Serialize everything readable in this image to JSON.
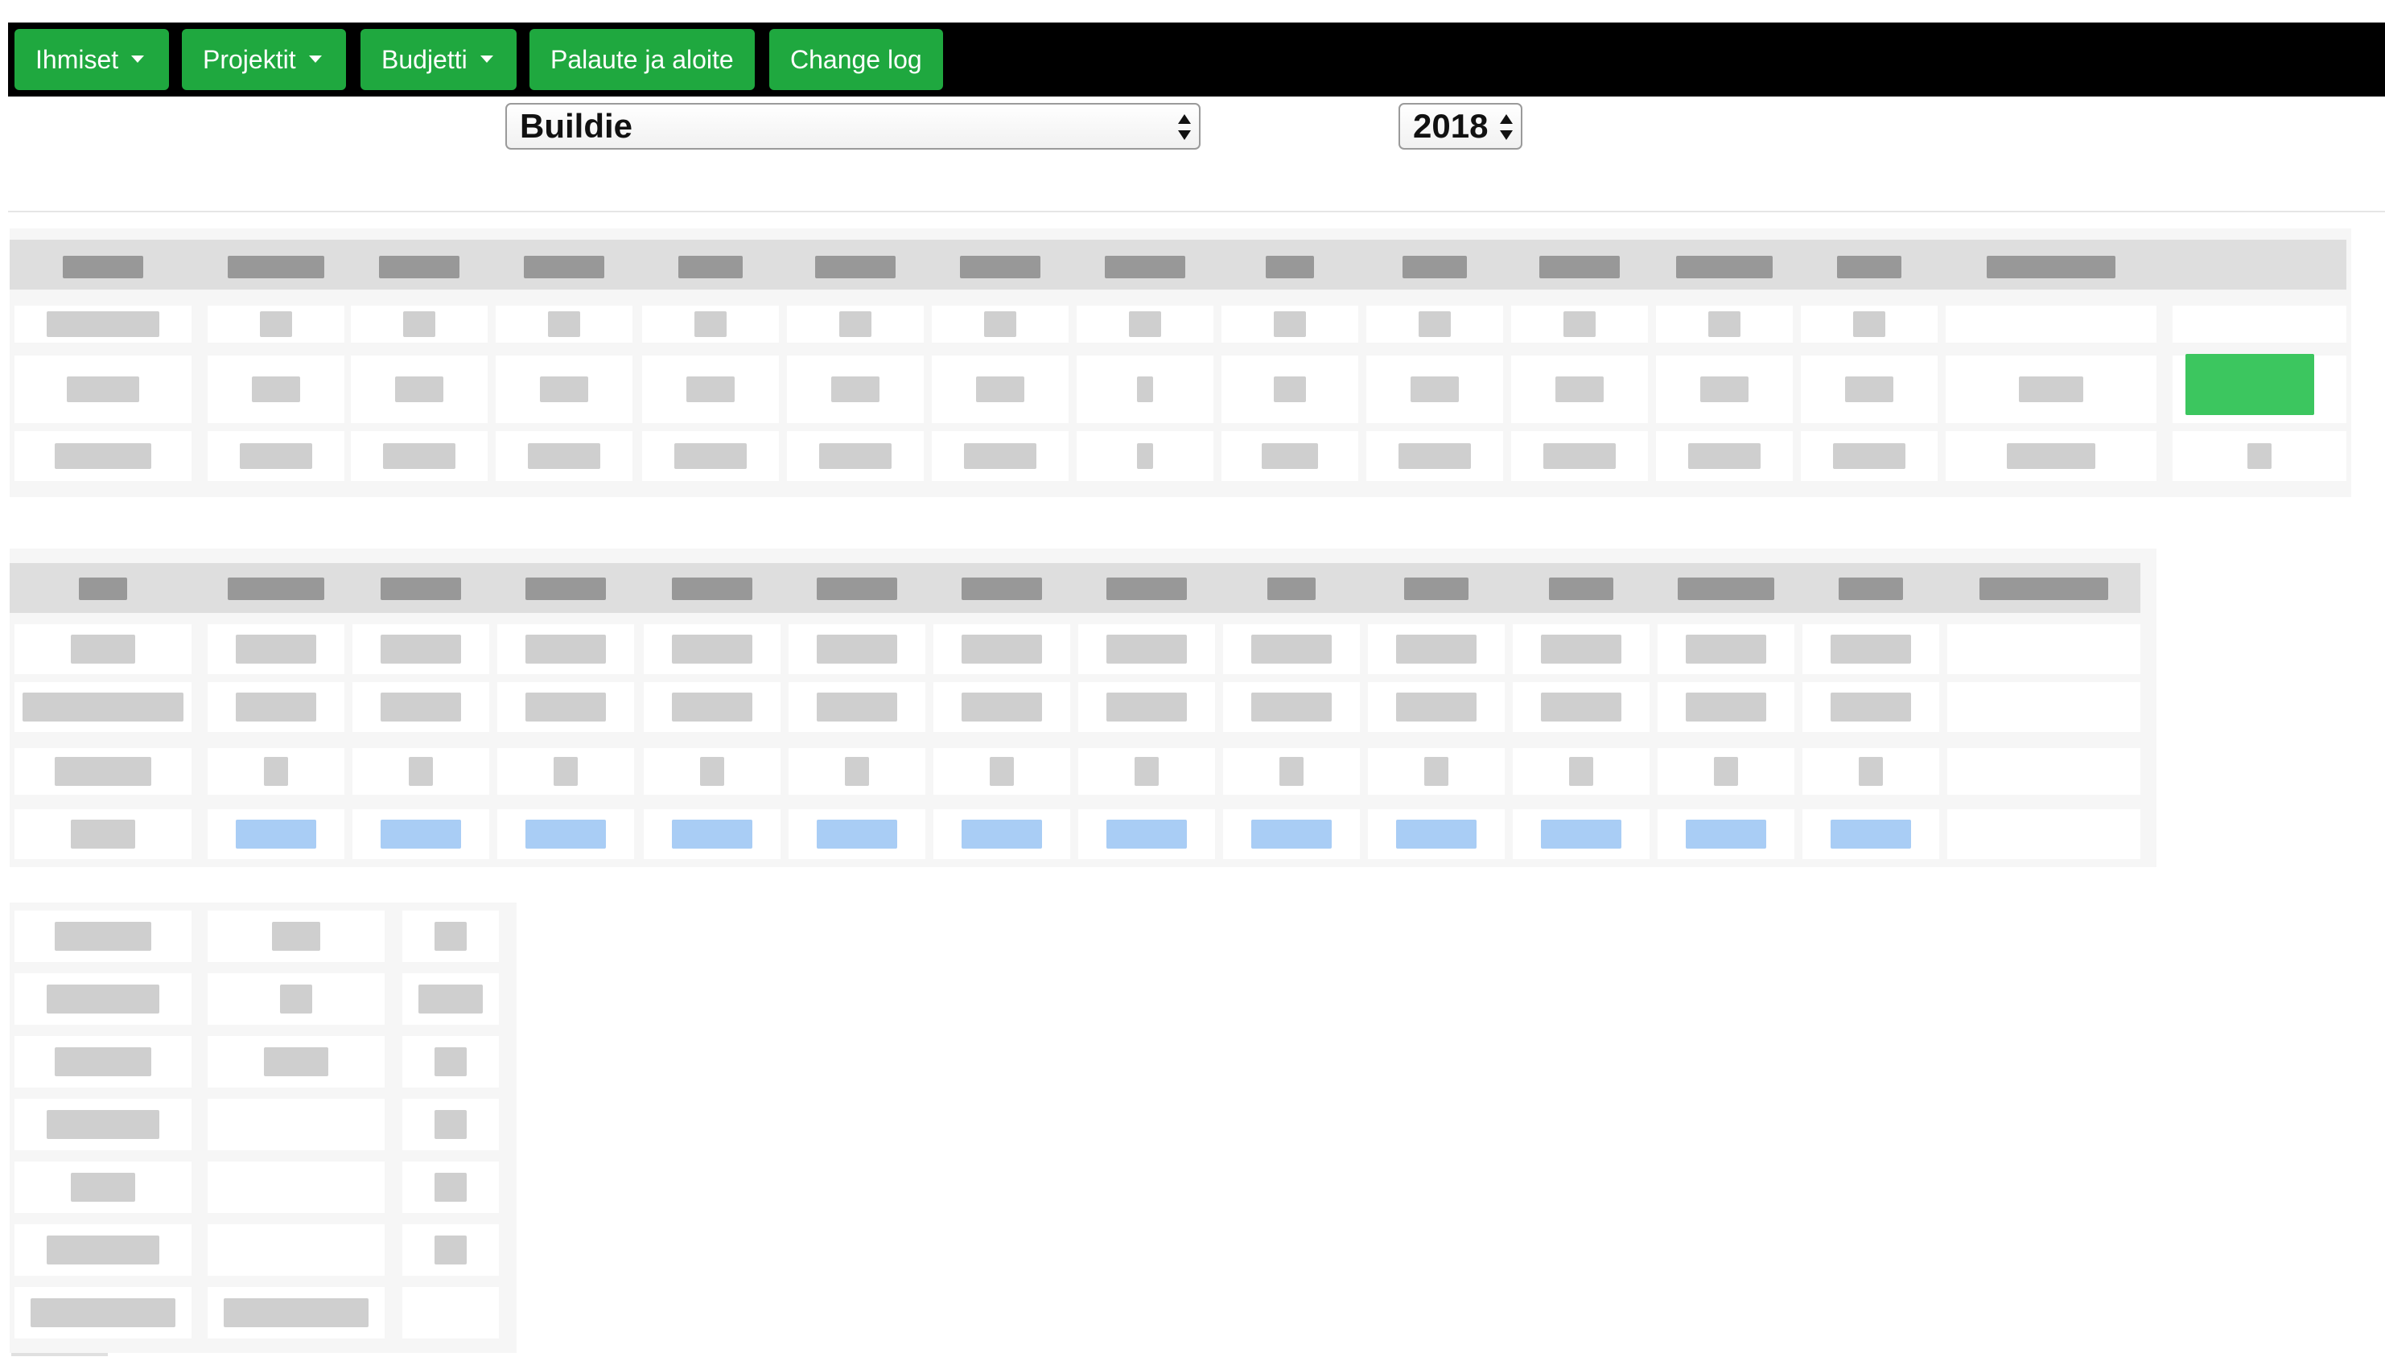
{
  "nav": {
    "items": [
      {
        "label": "Ihmiset",
        "dropdown": true
      },
      {
        "label": "Projektit",
        "dropdown": true
      },
      {
        "label": "Budjetti",
        "dropdown": true
      },
      {
        "label": "Palaute ja aloite",
        "dropdown": false
      },
      {
        "label": "Change log",
        "dropdown": false
      }
    ]
  },
  "filters": {
    "project_select": "Buildie",
    "year_select": "2018"
  },
  "colors": {
    "nav_bar": "#000000",
    "nav_button": "#1fa83f",
    "highlight_cell": "#3cc65f",
    "blue_cell": "#a9cdf5"
  },
  "tables": {
    "note": "",
    "table1": {
      "columns": 15,
      "rows": 3,
      "highlighted_cell": {
        "row": 2,
        "column": 15
      }
    },
    "table2": {
      "columns": 14,
      "rows": 4,
      "blue_row": 4
    },
    "table3": {
      "columns": 3,
      "rows": 7
    }
  }
}
